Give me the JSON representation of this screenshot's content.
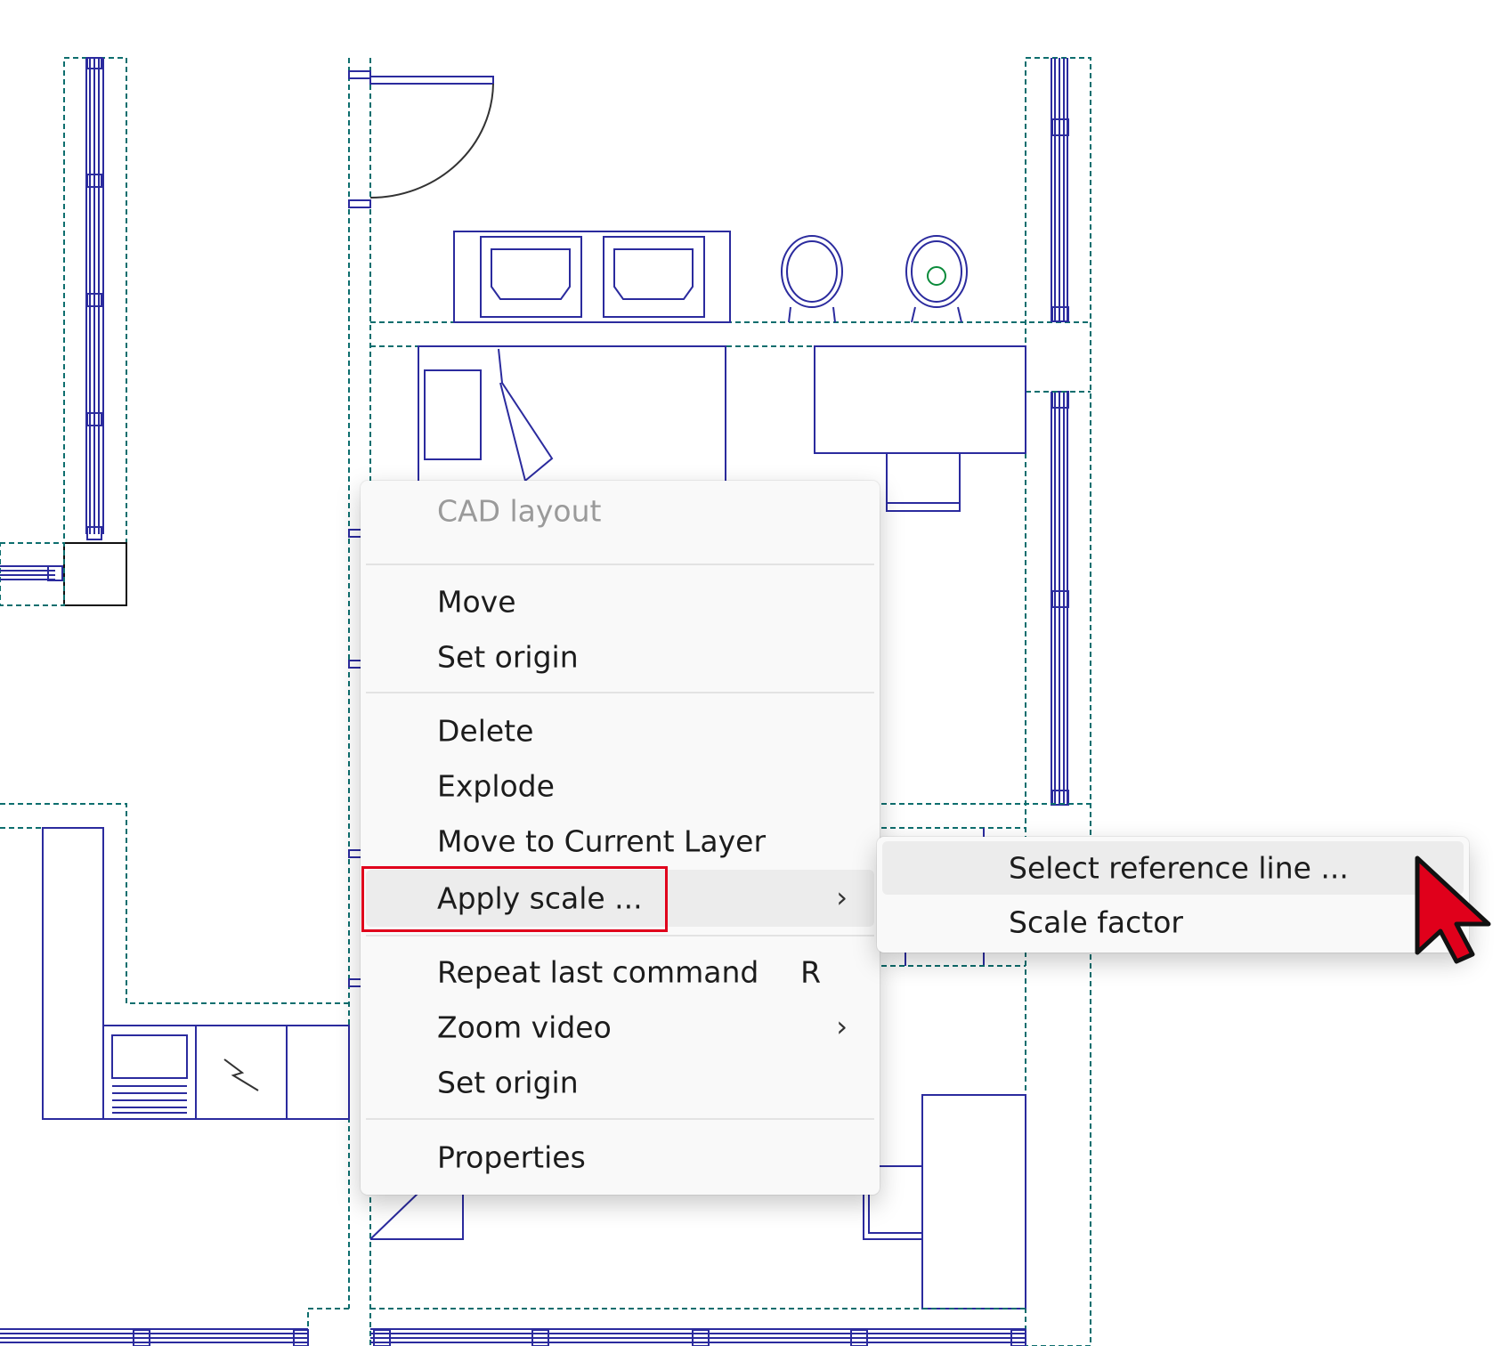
{
  "context_menu": {
    "header": "CAD layout",
    "items": [
      {
        "label": "Move"
      },
      {
        "label": "Set origin"
      },
      {
        "label": "Delete"
      },
      {
        "label": "Explode"
      },
      {
        "label": "Move to Current Layer"
      },
      {
        "label": "Apply scale ...",
        "submenu_chevron": "›"
      },
      {
        "label": "Repeat last command",
        "shortcut": "R"
      },
      {
        "label": "Zoom video",
        "submenu_chevron": "›"
      },
      {
        "label": "Set origin"
      },
      {
        "label": "Properties"
      }
    ]
  },
  "submenu": {
    "items": [
      {
        "label": "Select reference line ..."
      },
      {
        "label": "Scale factor"
      }
    ]
  },
  "colors": {
    "drawing_line": "#2b2b9e",
    "wall_dash": "#0d6e6e",
    "highlight_box": "#e0001b",
    "cursor": "#e0001b"
  },
  "icons": [
    "chevron-right-icon",
    "mouse-pointer-icon"
  ]
}
